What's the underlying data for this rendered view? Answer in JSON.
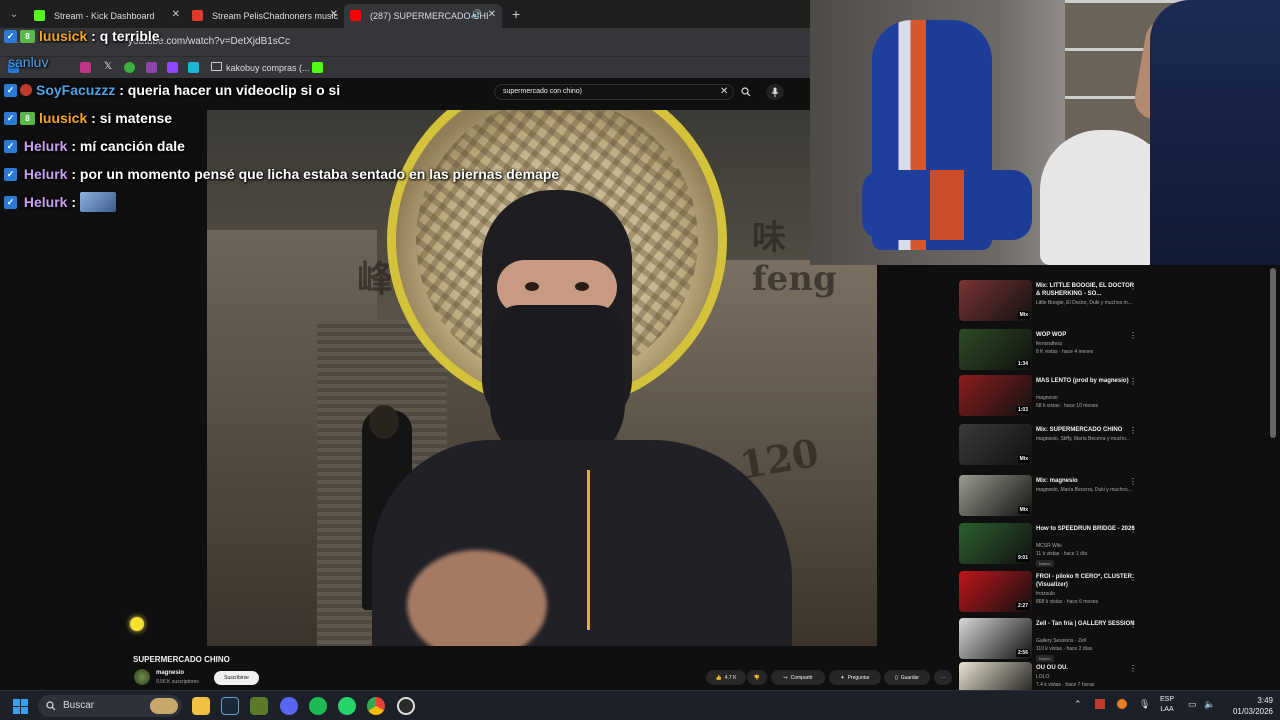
{
  "browser": {
    "tabs": [
      {
        "label": "Stream - Kick Dashboard",
        "color": "#53fc18",
        "active": false
      },
      {
        "label": "Stream PelisChadnoners music",
        "color": "#e03a2f",
        "active": false
      },
      {
        "label": "(287) SUPERMERCADO CHI",
        "color": "#ff0000",
        "active": true
      }
    ],
    "url": "youtube.com/watch?v=DetXjdB1sCc",
    "bookmark_label": "kakobuy compras (..."
  },
  "youtube": {
    "search_value": "supermercado con chino)",
    "video_title": "SUPERMERCADO CHINO",
    "channel_name": "magnesio",
    "channel_subs": "9.56 K suscriptores",
    "subscribe_label": "Suscribirse",
    "like_count": "4.7 K",
    "share_label": "Compartir",
    "ask_label": "Preguntar",
    "save_label": "Guardar"
  },
  "chat": [
    {
      "user": "luusick",
      "message": ": q terrible",
      "color": "#f5a623"
    },
    {
      "user": "sanluv",
      "message": "",
      "color": "#4fa3e8"
    },
    {
      "user": "SoyFacuzzz",
      "message": ": queria hacer un videoclip si o si",
      "color": "#4fa3e8"
    },
    {
      "user": "luusick",
      "message": ": si matense",
      "color": "#f5a623"
    },
    {
      "user": "Helurk",
      "message": ": mí canción dale",
      "color": "#c7a1f0"
    },
    {
      "user": "Helurk",
      "message": ": por un momento pensé que licha estaba sentado en las piernas demape",
      "color": "#c7a1f0"
    },
    {
      "user": "Helurk",
      "message": ":",
      "color": "#c7a1f0"
    }
  ],
  "related": [
    {
      "title": "Mix: LITTLE BOOGIE, EL DOCTOR & RUSHERKING - SO...",
      "meta1": "Little Boogie, El Doctor, Duki y muchos m...",
      "meta2": "",
      "time": "Mix",
      "thumb": "#7a3434",
      "nuevo": ""
    },
    {
      "title": "WOP WOP",
      "meta1": "fernorafless",
      "meta2": "8 K vistas · hace 4 meses",
      "time": "1:34",
      "thumb": "#2d4a23",
      "nuevo": ""
    },
    {
      "title": "MAS LENTO (prod by magnesio)",
      "meta1": "magnesio",
      "meta2": "68 k vistas · hace 10 meses",
      "time": "1:03",
      "thumb": "#8b1d1d",
      "nuevo": ""
    },
    {
      "title": "Mix: SUPERMERCADO CHINO",
      "meta1": "magnesio, Stiffy, María Becerra y mucho...",
      "meta2": "",
      "time": "Mix",
      "thumb": "#3a3a3a",
      "nuevo": ""
    },
    {
      "title": "Mix: magnesio",
      "meta1": "magnesio, María Becerra, Duki y muchos...",
      "meta2": "",
      "time": "Mix",
      "thumb": "#9b9b90",
      "nuevo": ""
    },
    {
      "title": "How to SPEEDRUN BRIDGE - 2026",
      "meta1": "MCSR Wiki",
      "meta2": "11 k vistas · hace 1 día",
      "time": "9:01",
      "thumb": "#2c5f2e",
      "nuevo": "Nuevo"
    },
    {
      "title": "FROI - piloko ft CERO*, CLUSTER (Visualizer)",
      "meta1": "froizoulo",
      "meta2": "868 k vistas · hace 6 meses",
      "time": "2:27",
      "thumb": "#c0161c",
      "nuevo": ""
    },
    {
      "title": "Zell - Tan fría | GALLERY SESSION",
      "meta1": "Gallery Sessions · Zell",
      "meta2": "110 k vistas · hace 2 días",
      "time": "2:56",
      "thumb": "#d8d8d8",
      "nuevo": "Nuevo"
    },
    {
      "title": "OU OU OU.",
      "meta1": "LOLO",
      "meta2": "7.4 k vistas · hace 7 horas",
      "time": "",
      "thumb": "#e8e2d0",
      "nuevo": ""
    }
  ],
  "taskbar": {
    "search_label": "Buscar",
    "lang_top": "ESP",
    "lang_bottom": "LAA",
    "time": "3:49",
    "date": "01/03/2026"
  }
}
